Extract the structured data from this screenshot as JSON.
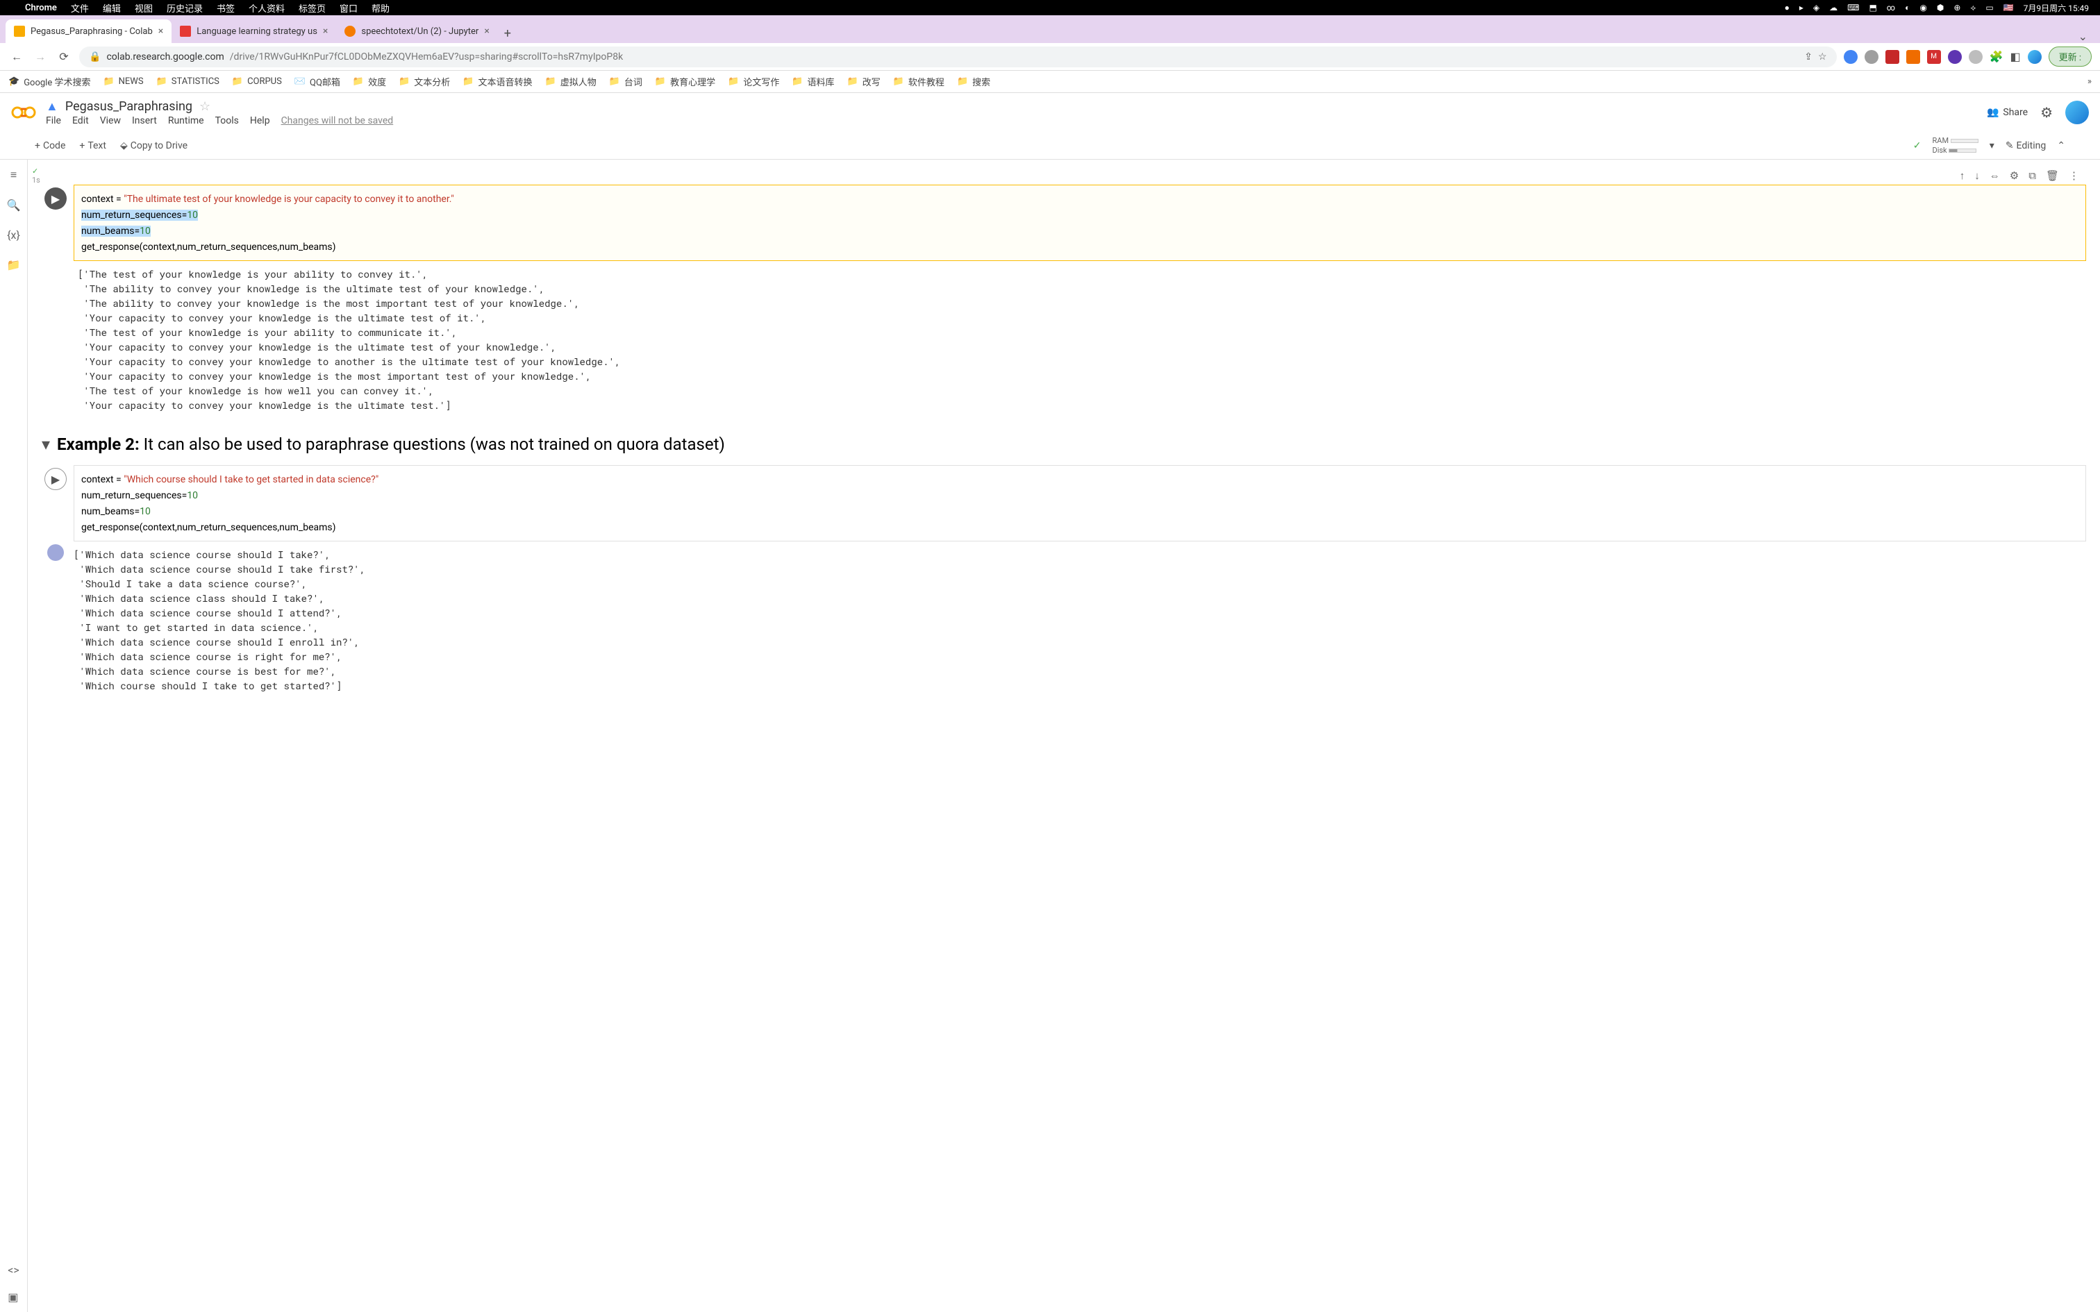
{
  "menubar": {
    "app": "Chrome",
    "items": [
      "文件",
      "编辑",
      "视图",
      "历史记录",
      "书签",
      "个人资料",
      "标签页",
      "窗口",
      "帮助"
    ],
    "clock": "7月9日周六 15:49"
  },
  "tabs": [
    {
      "label": "Pegasus_Paraphrasing - Colab",
      "favicon": "#f9ab00"
    },
    {
      "label": "Language learning strategy us",
      "favicon": "#e53935"
    },
    {
      "label": "speechtotext/Un (2) - Jupyter",
      "favicon": "#f57c00"
    }
  ],
  "url": {
    "host": "colab.research.google.com",
    "path": "/drive/1RWvGuHKnPur7fCL0DObMeZXQVHem6aEV?usp=sharing#scrollTo=hsR7myIpoP8k",
    "update": "更新 :"
  },
  "bookmarks": [
    "Google 学术搜索",
    "NEWS",
    "STATISTICS",
    "CORPUS",
    "QQ邮箱",
    "效度",
    "文本分析",
    "文本语音转换",
    "虚拟人物",
    "台词",
    "教育心理学",
    "论文写作",
    "语料库",
    "改写",
    "软件教程",
    "搜索"
  ],
  "colab": {
    "title": "Pegasus_Paraphrasing",
    "menus": [
      "File",
      "Edit",
      "View",
      "Insert",
      "Runtime",
      "Tools",
      "Help"
    ],
    "unsaved": "Changes will not be saved",
    "share": "Share",
    "code": "Code",
    "text": "Text",
    "copy": "Copy to Drive",
    "ram": "RAM",
    "disk": "Disk",
    "editing": "Editing",
    "exec_time": "1s"
  },
  "cell1": {
    "code": {
      "l1a": "context = ",
      "l1b": "\"The ultimate test of your knowledge is your capacity to convey it to another.\"",
      "l2a": "num_return_sequences=",
      "l2b": "10",
      "l3a": "num_beams=",
      "l3b": "10",
      "l4": "get_response(context,num_return_sequences,num_beams)"
    },
    "output": "['The test of your knowledge is your ability to convey it.',\n 'The ability to convey your knowledge is the ultimate test of your knowledge.',\n 'The ability to convey your knowledge is the most important test of your knowledge.',\n 'Your capacity to convey your knowledge is the ultimate test of it.',\n 'The test of your knowledge is your ability to communicate it.',\n 'Your capacity to convey your knowledge is the ultimate test of your knowledge.',\n 'Your capacity to convey your knowledge to another is the ultimate test of your knowledge.',\n 'Your capacity to convey your knowledge is the most important test of your knowledge.',\n 'The test of your knowledge is how well you can convey it.',\n 'Your capacity to convey your knowledge is the ultimate test.']"
  },
  "section": {
    "label": "Example 2:",
    "rest": " It can also be used to paraphrase questions (was not trained on quora dataset)"
  },
  "cell2": {
    "code": {
      "l1a": "context = ",
      "l1b": "\"Which course should I take to get started in data science?\"",
      "l2a": "num_return_sequences=",
      "l2b": "10",
      "l3a": "num_beams=",
      "l3b": "10",
      "l4": "get_response(context,num_return_sequences,num_beams)"
    },
    "output": "['Which data science course should I take?',\n 'Which data science course should I take first?',\n 'Should I take a data science course?',\n 'Which data science class should I take?',\n 'Which data science course should I attend?',\n 'I want to get started in data science.',\n 'Which data science course should I enroll in?',\n 'Which data science course is right for me?',\n 'Which data science course is best for me?',\n 'Which course should I take to get started?']"
  }
}
